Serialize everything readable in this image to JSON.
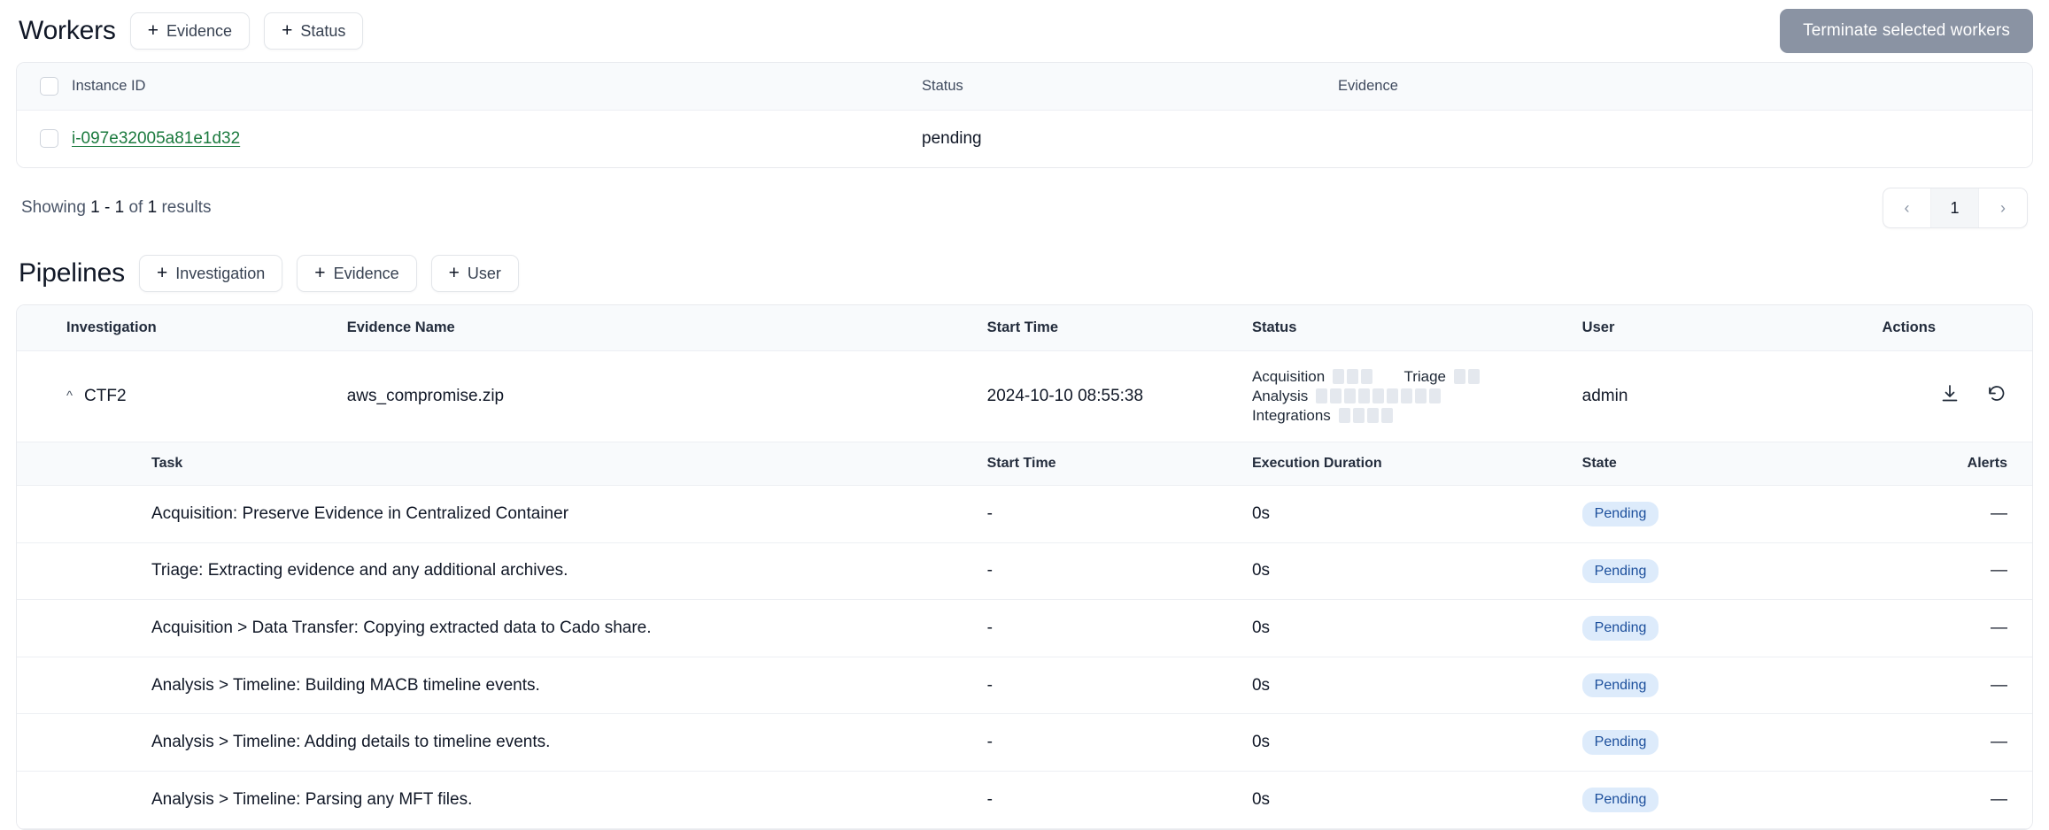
{
  "workers": {
    "title": "Workers",
    "buttons": [
      {
        "icon": "plus-icon",
        "label": "Evidence"
      },
      {
        "icon": "plus-icon",
        "label": "Status"
      }
    ],
    "terminate_label": "Terminate selected workers",
    "columns": [
      "",
      "Instance ID",
      "Status",
      "Evidence"
    ],
    "rows": [
      {
        "instance_id": "i-097e32005a81e1d32",
        "status": "pending",
        "evidence": ""
      }
    ],
    "results_prefix": "Showing",
    "results_range": "1 - 1",
    "results_middle": "of",
    "results_total": "1",
    "results_suffix": "results",
    "pager": {
      "prev": "‹",
      "page": "1",
      "next": "›"
    }
  },
  "pipelines": {
    "title": "Pipelines",
    "buttons": [
      {
        "icon": "plus-icon",
        "label": "Investigation"
      },
      {
        "icon": "plus-icon",
        "label": "Evidence"
      },
      {
        "icon": "plus-icon",
        "label": "User"
      }
    ],
    "columns": [
      "Investigation",
      "Evidence Name",
      "Start Time",
      "Status",
      "User",
      "Actions"
    ],
    "row": {
      "investigation": "CTF2",
      "evidence_name": "aws_compromise.zip",
      "start_time": "2024-10-10 08:55:38",
      "user": "admin",
      "stages": [
        {
          "label": "Acquisition",
          "segments": 3,
          "completed": 0
        },
        {
          "label": "Triage",
          "segments": 2,
          "completed": 0
        },
        {
          "label": "Analysis",
          "segments": 9,
          "completed": 0
        },
        {
          "label": "Integrations",
          "segments": 4,
          "completed": 0
        }
      ],
      "actions": [
        "download-icon",
        "rerun-icon"
      ]
    },
    "task_columns": [
      "Task",
      "Start Time",
      "Execution Duration",
      "State",
      "Alerts"
    ],
    "tasks": [
      {
        "task": "Acquisition: Preserve Evidence in Centralized Container",
        "start_time": "-",
        "duration": "0s",
        "state": "Pending",
        "alerts": "—"
      },
      {
        "task": "Triage: Extracting evidence and any additional archives.",
        "start_time": "-",
        "duration": "0s",
        "state": "Pending",
        "alerts": "—"
      },
      {
        "task": "Acquisition > Data Transfer: Copying extracted data to Cado share.",
        "start_time": "-",
        "duration": "0s",
        "state": "Pending",
        "alerts": "—"
      },
      {
        "task": "Analysis > Timeline: Building MACB timeline events.",
        "start_time": "-",
        "duration": "0s",
        "state": "Pending",
        "alerts": "—"
      },
      {
        "task": "Analysis > Timeline: Adding details to timeline events.",
        "start_time": "-",
        "duration": "0s",
        "state": "Pending",
        "alerts": "—"
      },
      {
        "task": "Analysis > Timeline: Parsing any MFT files.",
        "start_time": "-",
        "duration": "0s",
        "state": "Pending",
        "alerts": "—"
      }
    ]
  },
  "colors": {
    "link_green": "#1b7a3e",
    "badge_bg": "#ddebfb",
    "badge_text": "#1c4f9c",
    "primary_button_bg": "#8a93a3",
    "segment_empty": "#e4e8ee"
  }
}
